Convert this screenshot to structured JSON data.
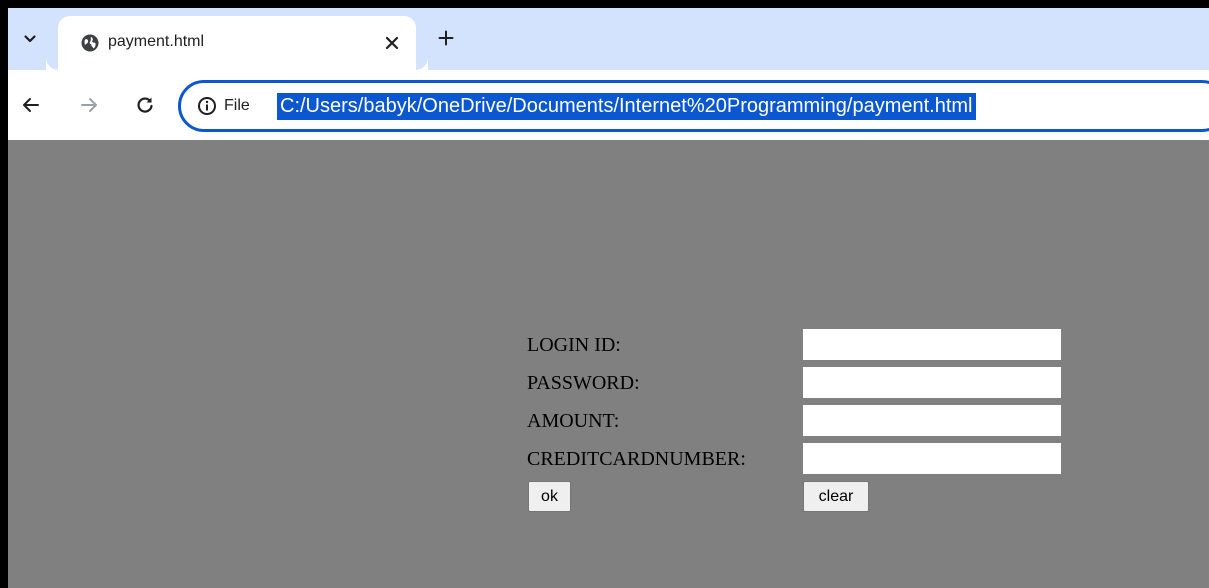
{
  "browser": {
    "tab": {
      "title": "payment.html"
    },
    "new_tab_symbol": "+",
    "close_symbol": "✕",
    "site_info_label": "File",
    "url": "C:/Users/babyk/OneDrive/Documents/Internet%20Programming/payment.html"
  },
  "form": {
    "fields": [
      {
        "label": "LOGIN ID:",
        "value": ""
      },
      {
        "label": "PASSWORD:",
        "value": ""
      },
      {
        "label": "AMOUNT:",
        "value": ""
      },
      {
        "label": "CREDITCARDNUMBER:",
        "value": ""
      }
    ],
    "ok_label": "ok",
    "clear_label": "clear"
  },
  "colors": {
    "page_background": "#808080",
    "tabstrip_background": "#d3e3fd",
    "omnibox_border": "#0b57d0",
    "url_selection": "#0b57d0"
  },
  "icons": {
    "tab_search": "chevron-down-icon",
    "favicon": "globe-icon",
    "back": "arrow-left-icon",
    "forward": "arrow-right-icon",
    "reload": "reload-icon",
    "site_info": "info-icon"
  }
}
